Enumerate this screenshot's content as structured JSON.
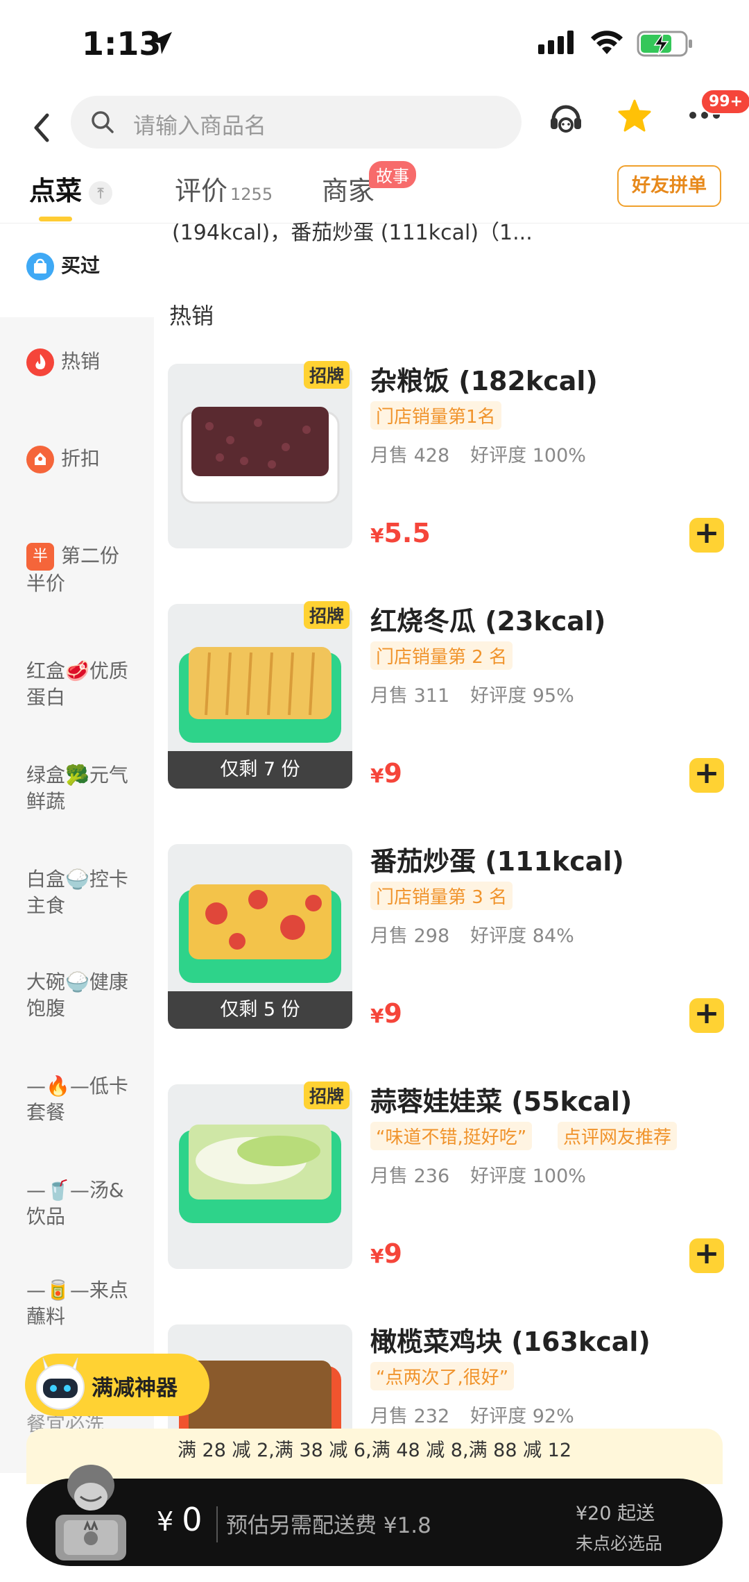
{
  "status_bar": {
    "time": "1:13"
  },
  "header": {
    "search_placeholder": "请输入商品名",
    "more_badge": "99+"
  },
  "tabs": [
    {
      "label": "点菜"
    },
    {
      "label": "评价",
      "count": "1255"
    },
    {
      "label": "商家",
      "badge": "故事"
    }
  ],
  "friend_button": "好友拼单",
  "sidebar": {
    "items": [
      {
        "label": "买过",
        "icon": "bag-icon",
        "color": "#3fa9f5"
      },
      {
        "label": "热销",
        "icon": "fire-icon",
        "color": "#f5453a"
      },
      {
        "label": "折扣",
        "icon": "discount-icon",
        "color": "#f5653a"
      },
      {
        "label": "第二份半价",
        "icon": "half-icon",
        "color": "#f5653a"
      },
      {
        "label": "红盒🥩优质蛋白"
      },
      {
        "label": "绿盒🥦元气鲜蔬"
      },
      {
        "label": "白盒🍚控卡主食"
      },
      {
        "label": "大碗🍚健康饱腹"
      },
      {
        "label": "—🔥—低卡套餐"
      },
      {
        "label": "—🥤—汤&饮品"
      },
      {
        "label": "—🥫—来点蘸料"
      }
    ],
    "under_text": "餐宜必洗"
  },
  "content": {
    "cut_text": "(194kcal)，番茄炒蛋 (111kcal)（1...",
    "section_title": "热销",
    "products": [
      {
        "name": "杂粮饭 (182kcal)",
        "sign": "招牌",
        "tags": [
          "门店销量第1名"
        ],
        "monthly": "月售 428",
        "rating": "好评度 100%",
        "price_symbol": "¥",
        "price": "5.5",
        "remaining": ""
      },
      {
        "name": "红烧冬瓜 (23kcal)",
        "sign": "招牌",
        "tags": [
          "门店销量第 2 名"
        ],
        "monthly": "月售 311",
        "rating": "好评度 95%",
        "price_symbol": "¥",
        "price": "9",
        "remaining": "仅剩 7 份"
      },
      {
        "name": "番茄炒蛋 (111kcal)",
        "sign": "",
        "tags": [
          "门店销量第 3 名"
        ],
        "monthly": "月售 298",
        "rating": "好评度 84%",
        "price_symbol": "¥",
        "price": "9",
        "remaining": "仅剩 5 份"
      },
      {
        "name": "蒜蓉娃娃菜 (55kcal)",
        "sign": "招牌",
        "tags": [
          "“味道不错,挺好吃”",
          "点评网友推荐"
        ],
        "monthly": "月售 236",
        "rating": "好评度 100%",
        "price_symbol": "¥",
        "price": "9",
        "remaining": ""
      },
      {
        "name": "橄榄菜鸡块 (163kcal)",
        "sign": "",
        "tags": [
          "“点两次了,很好”"
        ],
        "monthly": "月售 232",
        "rating": "好评度 92%",
        "price_symbol": "",
        "price": "",
        "remaining": ""
      }
    ]
  },
  "promo_button": "满减神器",
  "discount_strip": "满 28 减 2,满 38 减 6,满 48 减 8,满 88 减 12",
  "cart": {
    "currency": "¥",
    "total": "0",
    "delivery_fee": "预估另需配送费 ¥1.8",
    "min_order": "¥20 起送",
    "must_item": "未点必选品"
  },
  "colors": {
    "accent": "#ffd233",
    "price": "#f5453a",
    "tag_text": "#f0932b"
  }
}
